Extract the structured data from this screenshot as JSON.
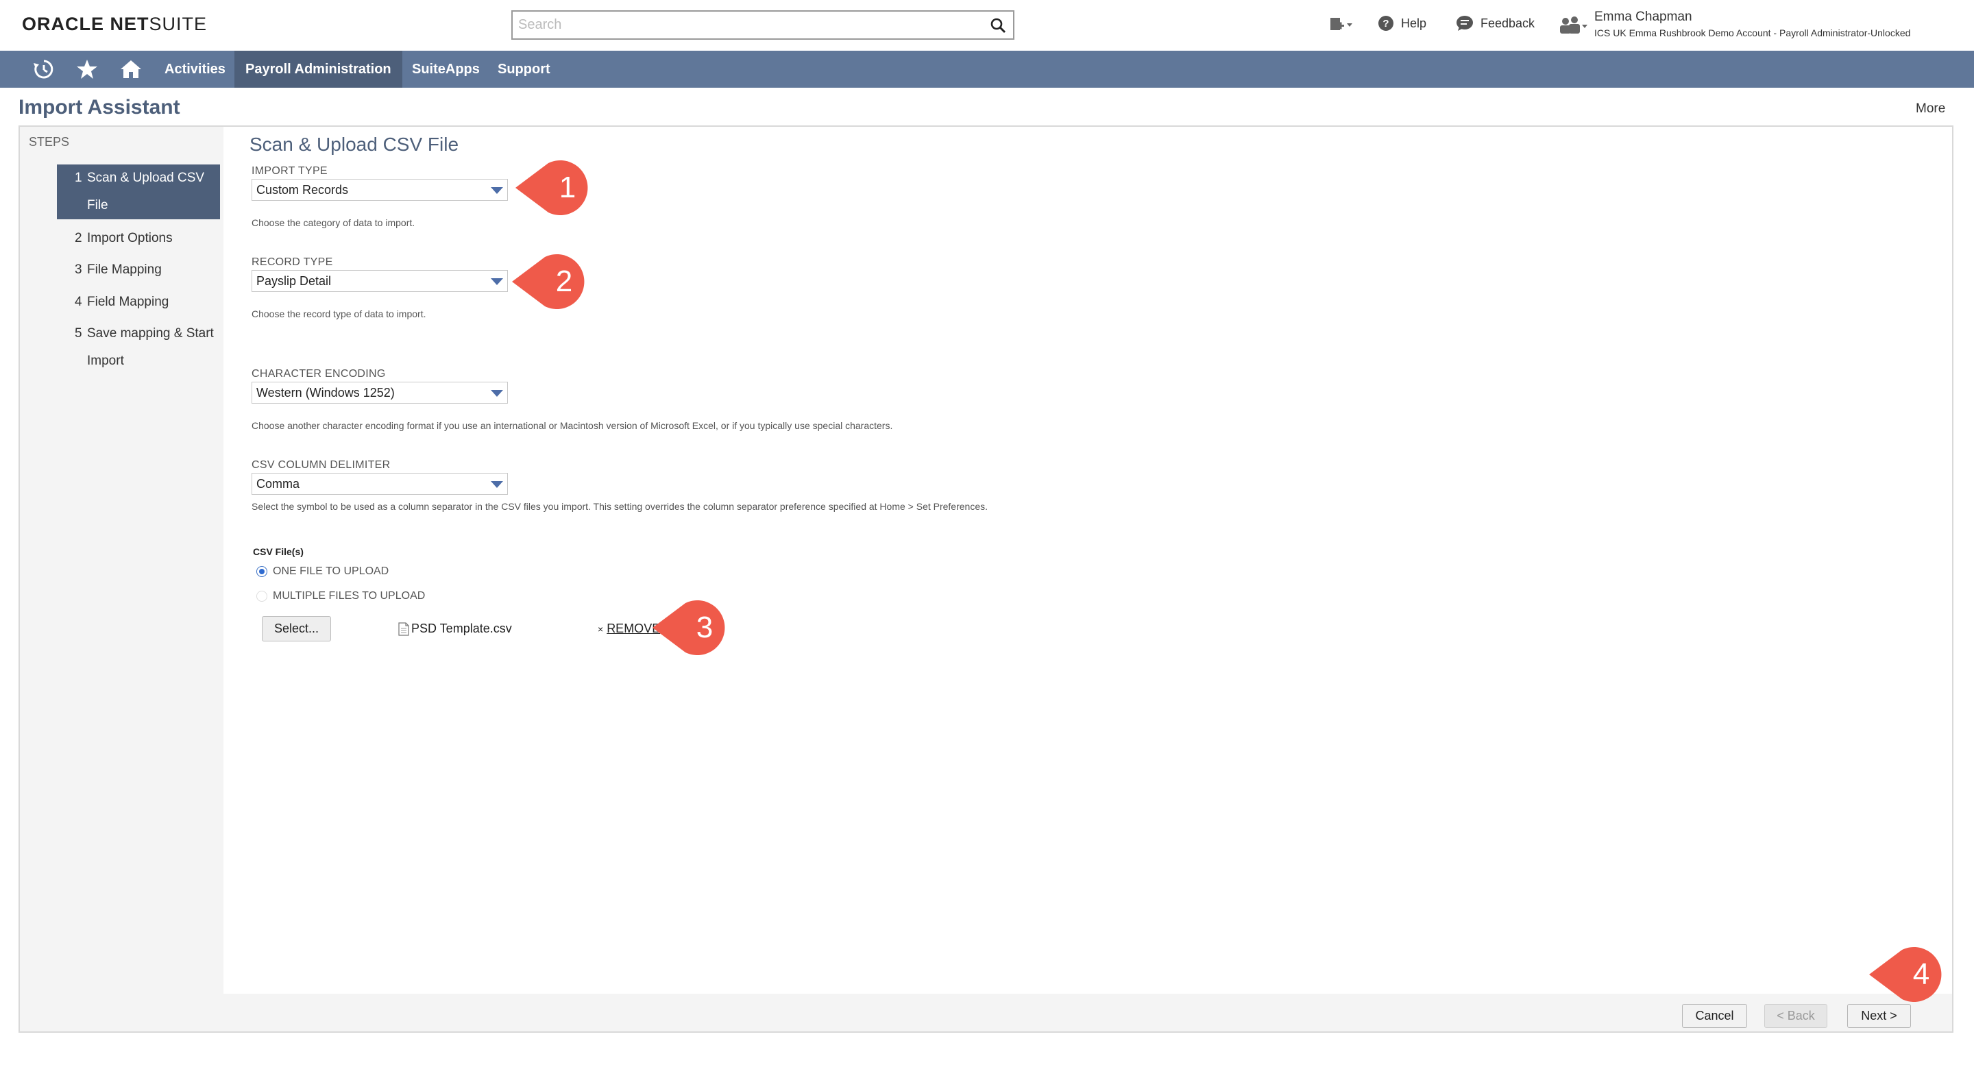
{
  "header": {
    "logo_bold": "ORACLE NET",
    "logo_light": "SUITE",
    "search_placeholder": "Search",
    "help_label": "Help",
    "feedback_label": "Feedback",
    "user_name": "Emma Chapman",
    "user_account": "ICS UK Emma Rushbrook Demo Account - Payroll Administrator-Unlocked"
  },
  "nav": {
    "items": [
      "Activities",
      "Payroll Administration",
      "SuiteApps",
      "Support"
    ],
    "active": "Payroll Administration"
  },
  "page": {
    "title": "Import Assistant",
    "more_label": "More"
  },
  "steps": {
    "heading": "STEPS",
    "items": [
      {
        "num": "1",
        "label": "Scan & Upload CSV File",
        "active": true
      },
      {
        "num": "2",
        "label": "Import Options",
        "active": false
      },
      {
        "num": "3",
        "label": "File Mapping",
        "active": false
      },
      {
        "num": "4",
        "label": "Field Mapping",
        "active": false
      },
      {
        "num": "5",
        "label": "Save mapping & Start Import",
        "active": false
      }
    ]
  },
  "form": {
    "section_title": "Scan & Upload CSV File",
    "import_type": {
      "label": "IMPORT TYPE",
      "value": "Custom Records",
      "help": "Choose the category of data to import."
    },
    "record_type": {
      "label": "RECORD TYPE",
      "value": "Payslip Detail",
      "help": "Choose the record type of data to import."
    },
    "character_encoding": {
      "label": "CHARACTER ENCODING",
      "value": "Western (Windows 1252)",
      "help": "Choose another character encoding format if you use an international or Macintosh version of Microsoft Excel, or if you typically use special characters."
    },
    "csv_delimiter": {
      "label": "CSV COLUMN DELIMITER",
      "value": "Comma",
      "help": "Select the symbol to be used as a column separator in the CSV files you import. This setting overrides the column separator preference specified at Home > Set Preferences."
    },
    "csv_files": {
      "label": "CSV File(s)",
      "option_one": "ONE FILE TO UPLOAD",
      "option_multiple": "MULTIPLE FILES TO UPLOAD",
      "selected": "ONE FILE TO UPLOAD",
      "select_button": "Select...",
      "file_name": "PSD Template.csv",
      "remove_x": "×",
      "remove_label": "REMOVE"
    }
  },
  "footer": {
    "cancel_label": "Cancel",
    "back_label": "< Back",
    "next_label": "Next >"
  },
  "callouts": [
    "1",
    "2",
    "3",
    "4"
  ],
  "colors": {
    "nav_bg": "#607799",
    "nav_active": "#4d5f7a",
    "title": "#4d5f7a",
    "callout": "#ef5a4a"
  }
}
